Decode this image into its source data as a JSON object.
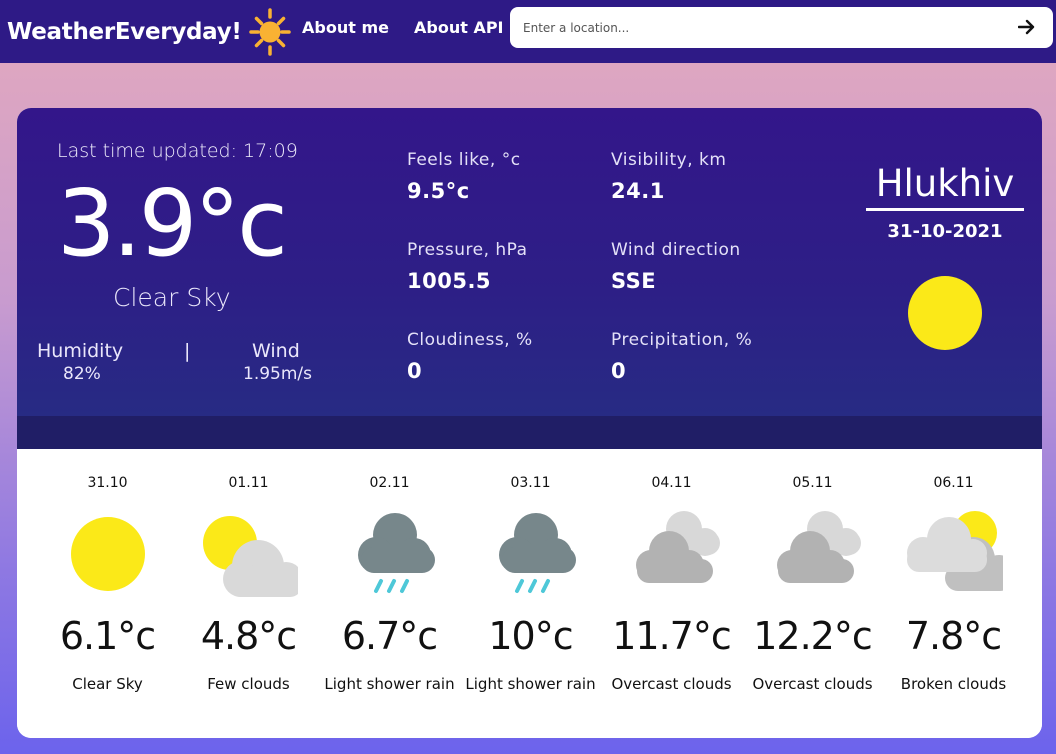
{
  "nav": {
    "brand": "WeatherEveryday!",
    "links": [
      "About me",
      "About API"
    ],
    "search_placeholder": "Enter a location...",
    "colors": {
      "bar": "#2e1a86",
      "sun": "#f9b233"
    }
  },
  "current": {
    "updated": "Last time updated: 17:09",
    "temperature": "3.9°c",
    "condition": "Clear Sky",
    "humidity_label": "Humidity",
    "humidity_value": "82%",
    "divider": "|",
    "wind_label": "Wind",
    "wind_value": "1.95m/s",
    "metrics": [
      {
        "label": "Feels like, °c",
        "value": "9.5°c"
      },
      {
        "label": "Visibility, km",
        "value": "24.1"
      },
      {
        "label": "Pressure, hPa",
        "value": "1005.5"
      },
      {
        "label": "Wind direction",
        "value": "SSE"
      },
      {
        "label": "Cloudiness, %",
        "value": "0"
      },
      {
        "label": "Precipitation, %",
        "value": "0"
      }
    ],
    "city": "Hlukhiv",
    "date": "31-10-2021",
    "icon": "sun-icon"
  },
  "forecast": [
    {
      "date": "31.10",
      "temp": "6.1°c",
      "desc": "Clear Sky",
      "icon": "sun-icon"
    },
    {
      "date": "01.11",
      "temp": "4.8°c",
      "desc": "Few clouds",
      "icon": "sun-cloud-icon"
    },
    {
      "date": "02.11",
      "temp": "6.7°c",
      "desc": "Light shower rain",
      "icon": "rain-icon"
    },
    {
      "date": "03.11",
      "temp": "10°c",
      "desc": "Light shower rain",
      "icon": "rain-icon"
    },
    {
      "date": "04.11",
      "temp": "11.7°c",
      "desc": "Overcast clouds",
      "icon": "overcast-icon"
    },
    {
      "date": "05.11",
      "temp": "12.2°c",
      "desc": "Overcast clouds",
      "icon": "overcast-icon"
    },
    {
      "date": "06.11",
      "temp": "7.8°c",
      "desc": "Broken clouds",
      "icon": "broken-clouds-icon"
    }
  ]
}
